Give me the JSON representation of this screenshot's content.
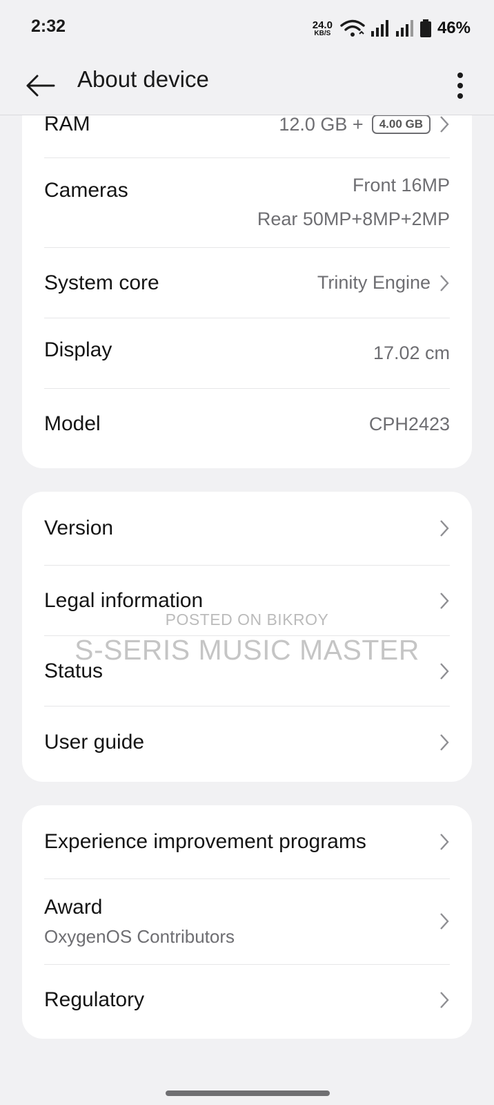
{
  "status_bar": {
    "time": "2:32",
    "net_speed_value": "24.0",
    "net_speed_unit": "KB/S",
    "battery_percent": "46%",
    "icons": [
      "wifi-icon",
      "signal-icon",
      "signal-icon",
      "battery-icon"
    ]
  },
  "app_bar": {
    "title": "About device",
    "back_icon": "back-arrow-icon",
    "more_icon": "more-vertical-icon"
  },
  "specs": {
    "ram": {
      "label": "RAM",
      "value": "12.0 GB +",
      "badge": "4.00 GB"
    },
    "cameras": {
      "label": "Cameras",
      "front": "Front 16MP",
      "rear": "Rear 50MP+8MP+2MP"
    },
    "system_core": {
      "label": "System core",
      "value": "Trinity Engine"
    },
    "display": {
      "label": "Display",
      "value": "17.02 cm"
    },
    "model": {
      "label": "Model",
      "value": "CPH2423"
    }
  },
  "info": {
    "version": "Version",
    "legal": "Legal information",
    "status": "Status",
    "user_guide": "User guide"
  },
  "more": {
    "experience": "Experience improvement programs",
    "award": "Award",
    "award_sub": "OxygenOS Contributors",
    "regulatory": "Regulatory"
  },
  "watermark": {
    "line1": "POSTED ON BIKROY",
    "line2": "S-SERIS MUSIC MASTER"
  },
  "colors": {
    "background": "#f1f1f3",
    "card": "#ffffff",
    "secondary_text": "#6e6e72"
  }
}
